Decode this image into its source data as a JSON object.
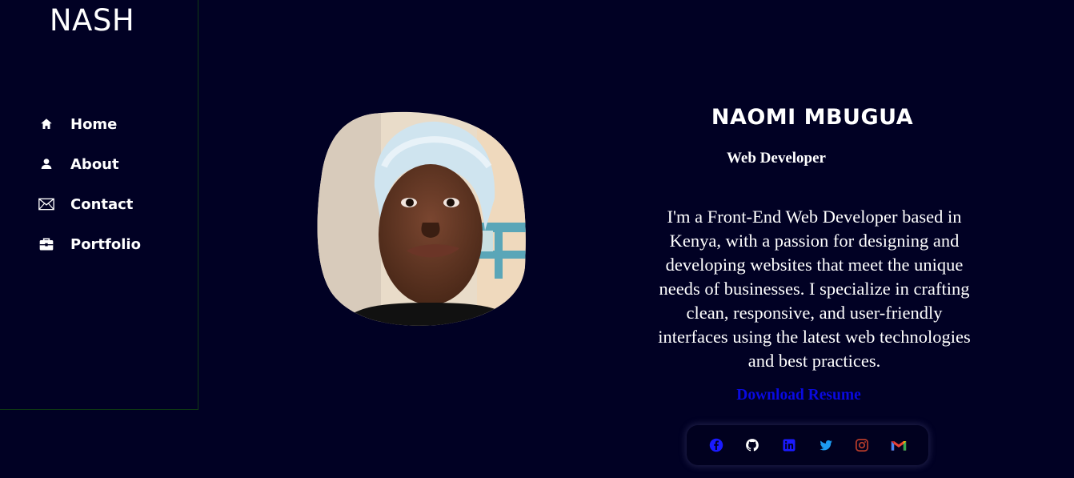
{
  "sidebar": {
    "brand": "NASH",
    "items": [
      {
        "label": "Home",
        "icon": "home-icon"
      },
      {
        "label": "About",
        "icon": "user-icon"
      },
      {
        "label": "Contact",
        "icon": "envelope-icon"
      },
      {
        "label": "Portfolio",
        "icon": "briefcase-icon"
      }
    ]
  },
  "profile": {
    "photo_alt": "Profile photo of Naomi Mbugua"
  },
  "intro": {
    "name": "NAOMI MBUGUA",
    "role": "Web Developer",
    "bio": "I'm a Front-End Web Developer based in Kenya, with a passion for designing and developing websites that meet the unique needs of businesses. I specialize in crafting clean, responsive, and user-friendly interfaces using the latest web technologies and best practices.",
    "resume_label": "Download Resume"
  },
  "social": [
    {
      "icon": "facebook-icon",
      "color": "#1a1aff"
    },
    {
      "icon": "github-icon",
      "color": "#ffffff"
    },
    {
      "icon": "linkedin-icon",
      "color": "#1a1aff"
    },
    {
      "icon": "twitter-icon",
      "color": "#1d9bf0"
    },
    {
      "icon": "instagram-icon",
      "color": "#b23a2a"
    },
    {
      "icon": "gmail-icon",
      "color": "#ea4335"
    }
  ],
  "colors": {
    "background": "#010124",
    "accent_link": "#0a0ae0",
    "sidebar_border": "#0f3a12"
  }
}
